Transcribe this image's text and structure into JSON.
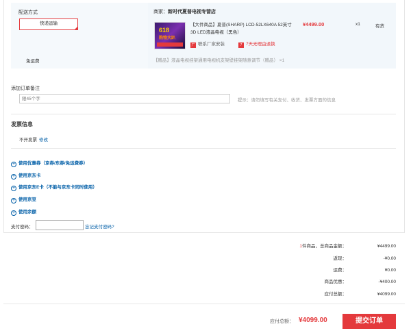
{
  "shipping": {
    "title": "配送方式",
    "method": "快递运输",
    "free": "免运费"
  },
  "item": {
    "seller_prefix": "商家：",
    "seller": "新时代夏普电视专营店",
    "thumb_line1": "618",
    "thumb_line2": "购物大趴",
    "name": "【大件商品】夏普(SHARP) LCD-52LX640A 52英寸 3D LED液晶电视（黑色）",
    "price": "¥4499.00",
    "qty": "x1",
    "stock": "有货",
    "svc1": "联系厂家安装",
    "svc1_icon": "厂",
    "svc2": "7天无理由退换",
    "svc2_icon": "7",
    "gift": "【赠品】液晶电视挂架通用电视机支架壁挂架随意调节（赠品） ×1"
  },
  "remark": {
    "label": "添加订单备注",
    "placeholder": "限45个字",
    "tip": "提示：请勿填写有关支付、收货、发票方面的信息"
  },
  "invoice": {
    "title": "发票信息",
    "value": "不开发票",
    "edit": "修改"
  },
  "options": [
    "使用优惠券（京券/东券/免运费券）",
    "使用京东卡",
    "使用京东E卡（不能与京东卡同时使用）",
    "使用京豆",
    "使用余额"
  ],
  "pay": {
    "label": "支付密码：",
    "forgot": "忘记支付密码?"
  },
  "summary": {
    "count": "1",
    "count_suffix": "件商品，总商品金额：",
    "total_goods": "¥4499.00",
    "rebate_label": "返现：",
    "rebate": "-¥0.00",
    "freight_label": "运费：",
    "freight": "¥0.00",
    "discount_label": "商品优惠：",
    "discount": "-¥400.00",
    "due_label": "应付总额：",
    "due": "¥4099.00"
  },
  "footer": {
    "total_label": "应付总额：",
    "total": "¥4099.00",
    "submit": "提交订单"
  },
  "colors": {
    "accent": "#e4393c",
    "link": "#005ea7"
  }
}
